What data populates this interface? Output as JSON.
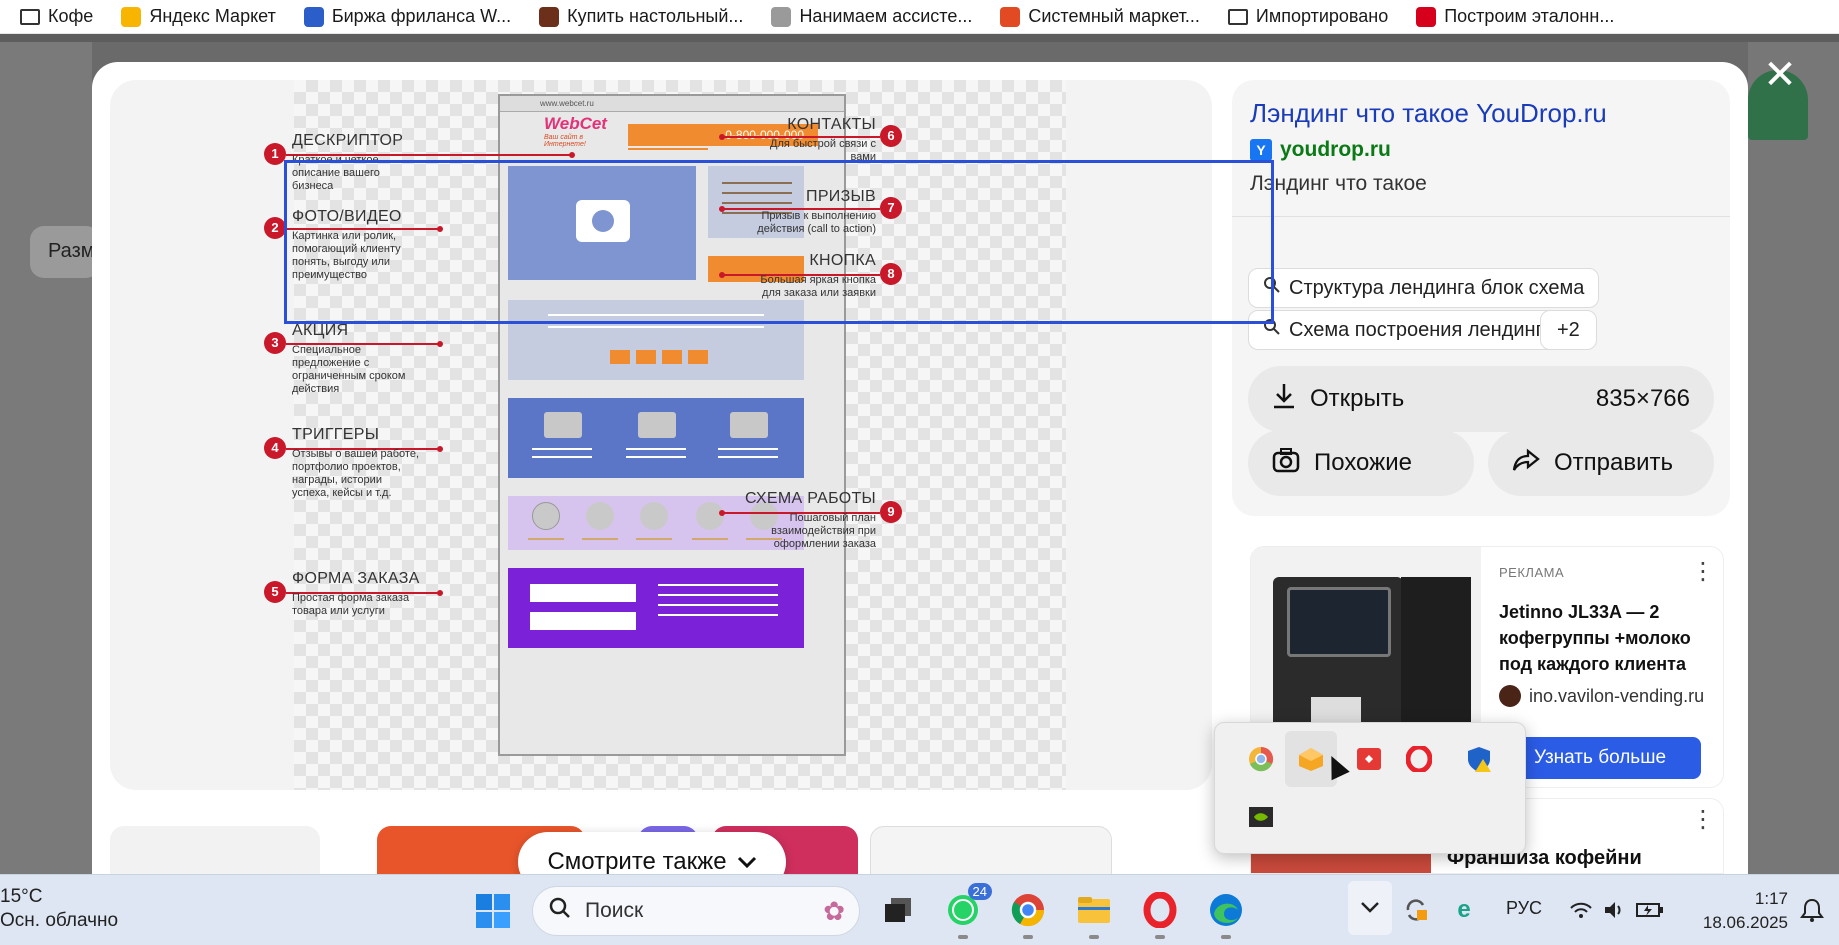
{
  "bookmarks": [
    {
      "label": "Кофе",
      "icon": "folder-icon",
      "color": ""
    },
    {
      "label": "Яндекс Маркет",
      "icon": "yandex-market-icon",
      "color": "#f7b500"
    },
    {
      "label": "Биржа фриланса W...",
      "icon": "weblancer-icon",
      "color": "#2c5ec9"
    },
    {
      "label": "Купить настольный...",
      "icon": "bag-icon",
      "color": "#6b2f1a"
    },
    {
      "label": "Нанимаем ассисте...",
      "icon": "brain-icon",
      "color": "#9a9a9a"
    },
    {
      "label": "Системный маркет...",
      "icon": "bars-icon",
      "color": "#e24a24"
    },
    {
      "label": "Импортировано",
      "icon": "folder-icon",
      "color": ""
    },
    {
      "label": "Построим эталонн...",
      "icon": "hh-icon",
      "color": "#d6001c"
    }
  ],
  "background": {
    "chip_label": "Разм"
  },
  "infographic": {
    "site_name": "WebCet",
    "tagline": "Ваш сайт в Интернете!",
    "url_text": "www.webcet.ru",
    "phone": "0-800-000-000",
    "left_items": [
      {
        "num": "1",
        "title": "ДЕСКРИПТОР",
        "desc": "Краткое и четкое описание вашего бизнеса"
      },
      {
        "num": "2",
        "title": "ФОТО/ВИДЕО",
        "desc": "Картинка или ролик, помогающий клиенту понять, выгоду или преимущество"
      },
      {
        "num": "3",
        "title": "АКЦИЯ",
        "desc": "Специальное предложение с ограниченным сроком действия"
      },
      {
        "num": "4",
        "title": "ТРИГГЕРЫ",
        "desc": "Отзывы о вашей работе, портфолио проектов, награды, истории успеха, кейсы и т.д."
      },
      {
        "num": "5",
        "title": "ФОРМА ЗАКАЗА",
        "desc": "Простая форма заказа товара или услуги"
      }
    ],
    "right_items": [
      {
        "num": "6",
        "title": "КОНТАКТЫ",
        "desc": "Для быстрой связи с вами"
      },
      {
        "num": "7",
        "title": "ПРИЗЫВ",
        "desc": "Призыв к выполнению действия (call to action)"
      },
      {
        "num": "8",
        "title": "КНОПКА",
        "desc": "Большая яркая кнопка для заказа или заявки"
      },
      {
        "num": "9",
        "title": "СХЕМА РАБОТЫ",
        "desc": "Пошаговый план взаимодействия при оформлении заказа"
      }
    ],
    "colors": {
      "orange": "#f08b2f",
      "blue_block": "#7f95d1",
      "grey_block": "#c5cce0",
      "triggers": "#5b76c7",
      "steps": "#d6c4ef",
      "form": "#7b22d8",
      "marker": "#c8182a"
    }
  },
  "panel": {
    "title": "Лэндинг что такое YouDrop.ru",
    "site": "youdrop.ru",
    "subtitle": "Лэндинг что такое",
    "chips": [
      "Структура лендинга блок схема",
      "Схема построения лендинга",
      "+2"
    ],
    "open_label": "Открыть",
    "dimensions": "835×766",
    "similar_label": "Похожие",
    "share_label": "Отправить"
  },
  "ad": {
    "label": "РЕКЛАМА",
    "text": "Jetinno JL33A — 2 кофегруппы +молоко под каждого клиента",
    "url": "ino.vavilon-vending.ru",
    "button": "Узнать больше"
  },
  "ad2": {
    "title": "Франшиза кофейни"
  },
  "see_also": {
    "label": "Смотрите также"
  },
  "tray_icons": [
    "chrome-canary-icon",
    "yandex-disk-icon",
    "anydesk-icon",
    "opera-icon",
    "defender-warning-icon",
    "nvidia-icon"
  ],
  "taskbar": {
    "temperature": "15°C",
    "weather": "Осн. облачно",
    "search_placeholder": "Поиск",
    "whatsapp_badge": "24",
    "language": "РУС",
    "time": "1:17",
    "date": "18.06.2025"
  }
}
